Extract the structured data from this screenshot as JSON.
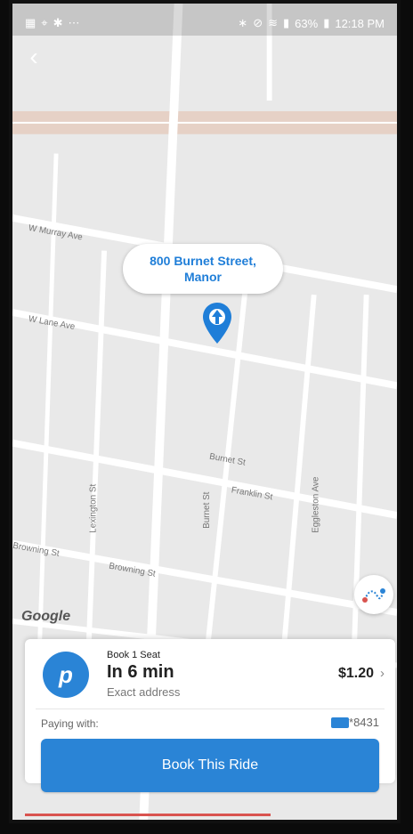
{
  "status": {
    "battery": "63%",
    "time": "12:18 PM",
    "left_icons": [
      "gallery-icon",
      "location-icon",
      "settings-icon",
      "more-icon"
    ],
    "right_icons": [
      "bluetooth-icon",
      "mute-icon",
      "wifi-icon",
      "signal-icon",
      "battery-icon"
    ]
  },
  "header": {
    "back_icon": "back-icon"
  },
  "map": {
    "address_line1": "800 Burnet Street,",
    "address_line2": "Manor",
    "google": "Google",
    "street_labels": [
      "W Murray Ave",
      "W Lane Ave",
      "Lexington St",
      "Burnet St",
      "Burnet St",
      "Franklin St",
      "Browning St",
      "Browning St",
      "Eggleston Ave"
    ]
  },
  "ride": {
    "title": "Book 1 Seat",
    "eta": "In 6 min",
    "detail": "Exact address",
    "price": "$1.20",
    "chevron": "›"
  },
  "payment": {
    "label": "Paying with:",
    "card_last4": "*8431"
  },
  "actions": {
    "book_label": "Book This Ride"
  },
  "colors": {
    "accent": "#2a84d6",
    "pin": "#1f7ed8",
    "progress": "#d9534f"
  }
}
